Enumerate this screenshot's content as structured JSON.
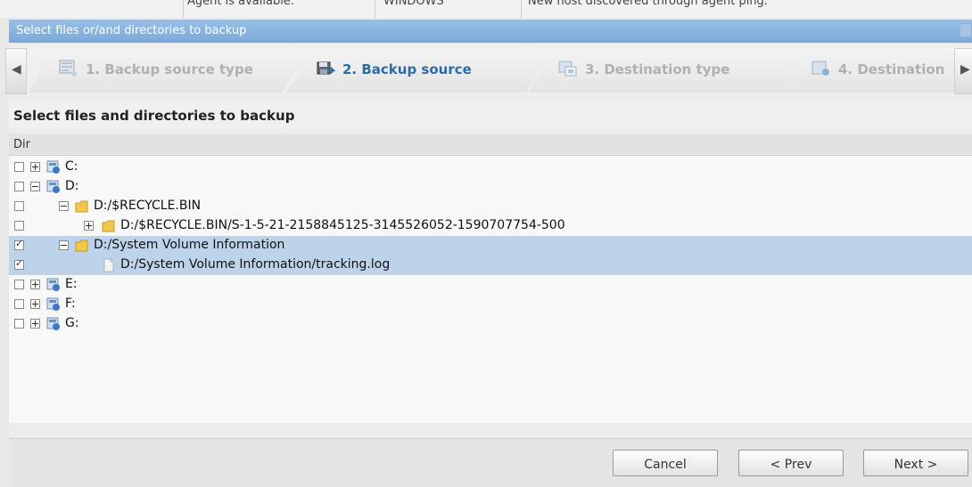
{
  "background_strip": {
    "cells": [
      "Agent is available.",
      "WINDOWS",
      "New host discovered through agent ping."
    ]
  },
  "dialog": {
    "title": "Select files or/and directories to backup"
  },
  "steps": [
    {
      "label": "1. Backup source type",
      "active": false,
      "icon": "monitor-icon"
    },
    {
      "label": "2. Backup source",
      "active": true,
      "icon": "backup-source-icon"
    },
    {
      "label": "3. Destination type",
      "active": false,
      "icon": "destination-type-icon"
    },
    {
      "label": "4. Destination",
      "active": false,
      "icon": "destination-icon"
    }
  ],
  "section_title": "Select files and directories to backup",
  "column_header": "Dir",
  "tree": [
    {
      "label": "C:",
      "checked": false,
      "expander": "plus",
      "icon": "drive-icon",
      "selected": false
    },
    {
      "label": "D:",
      "checked": false,
      "expander": "minus",
      "icon": "drive-icon",
      "selected": false
    },
    {
      "label": "D:/$RECYCLE.BIN",
      "checked": false,
      "expander": "minus",
      "icon": "folder-icon",
      "selected": false
    },
    {
      "label": "D:/$RECYCLE.BIN/S-1-5-21-2158845125-3145526052-1590707754-500",
      "checked": false,
      "expander": "plus",
      "icon": "folder-icon",
      "selected": false
    },
    {
      "label": "D:/System Volume Information",
      "checked": true,
      "expander": "minus",
      "icon": "folder-icon",
      "selected": true
    },
    {
      "label": "D:/System Volume Information/tracking.log",
      "checked": true,
      "expander": "none",
      "icon": "file-icon",
      "selected": true
    },
    {
      "label": "E:",
      "checked": false,
      "expander": "plus",
      "icon": "drive-icon",
      "selected": false
    },
    {
      "label": "F:",
      "checked": false,
      "expander": "plus",
      "icon": "drive-icon",
      "selected": false
    },
    {
      "label": "G:",
      "checked": false,
      "expander": "plus",
      "icon": "drive-icon",
      "selected": false
    }
  ],
  "buttons": {
    "cancel": "Cancel",
    "prev": "< Prev",
    "next": "Next >"
  },
  "colors": {
    "titlebar": "#7aa8d8",
    "active_step_text": "#2b6ca8",
    "selected_row": "#bcd3ea",
    "folder": "#f3c64c"
  }
}
